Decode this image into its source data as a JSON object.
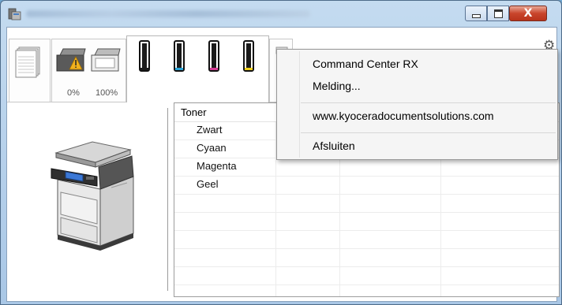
{
  "window": {
    "minimize_label": "",
    "maximize_label": "",
    "close_label": "X"
  },
  "tray_status": {
    "tray1_level": "0%",
    "tray2_level": "100%"
  },
  "table": {
    "columns": [
      "Toner",
      "",
      "",
      ""
    ],
    "rows": [
      {
        "name": "Zwart"
      },
      {
        "name": "Cyaan"
      },
      {
        "name": "Magenta"
      },
      {
        "name": "Geel"
      }
    ]
  },
  "toner_cartridges": [
    {
      "name": "Zwart",
      "color": "#1a1a1a"
    },
    {
      "name": "Cyaan",
      "color": "#2aa6d9"
    },
    {
      "name": "Magenta",
      "color": "#d63a94"
    },
    {
      "name": "Geel",
      "color": "#f2d21e"
    }
  ],
  "context_menu": {
    "items": [
      {
        "label": "Command Center RX"
      },
      {
        "label": "Melding..."
      },
      {
        "label": "www.kyoceradocumentsolutions.com"
      },
      {
        "label": "Afsluiten"
      }
    ]
  },
  "colors": {
    "titlebar": "#b9d3ec",
    "close_button": "#c9452c",
    "warning": "#f2b21e"
  }
}
